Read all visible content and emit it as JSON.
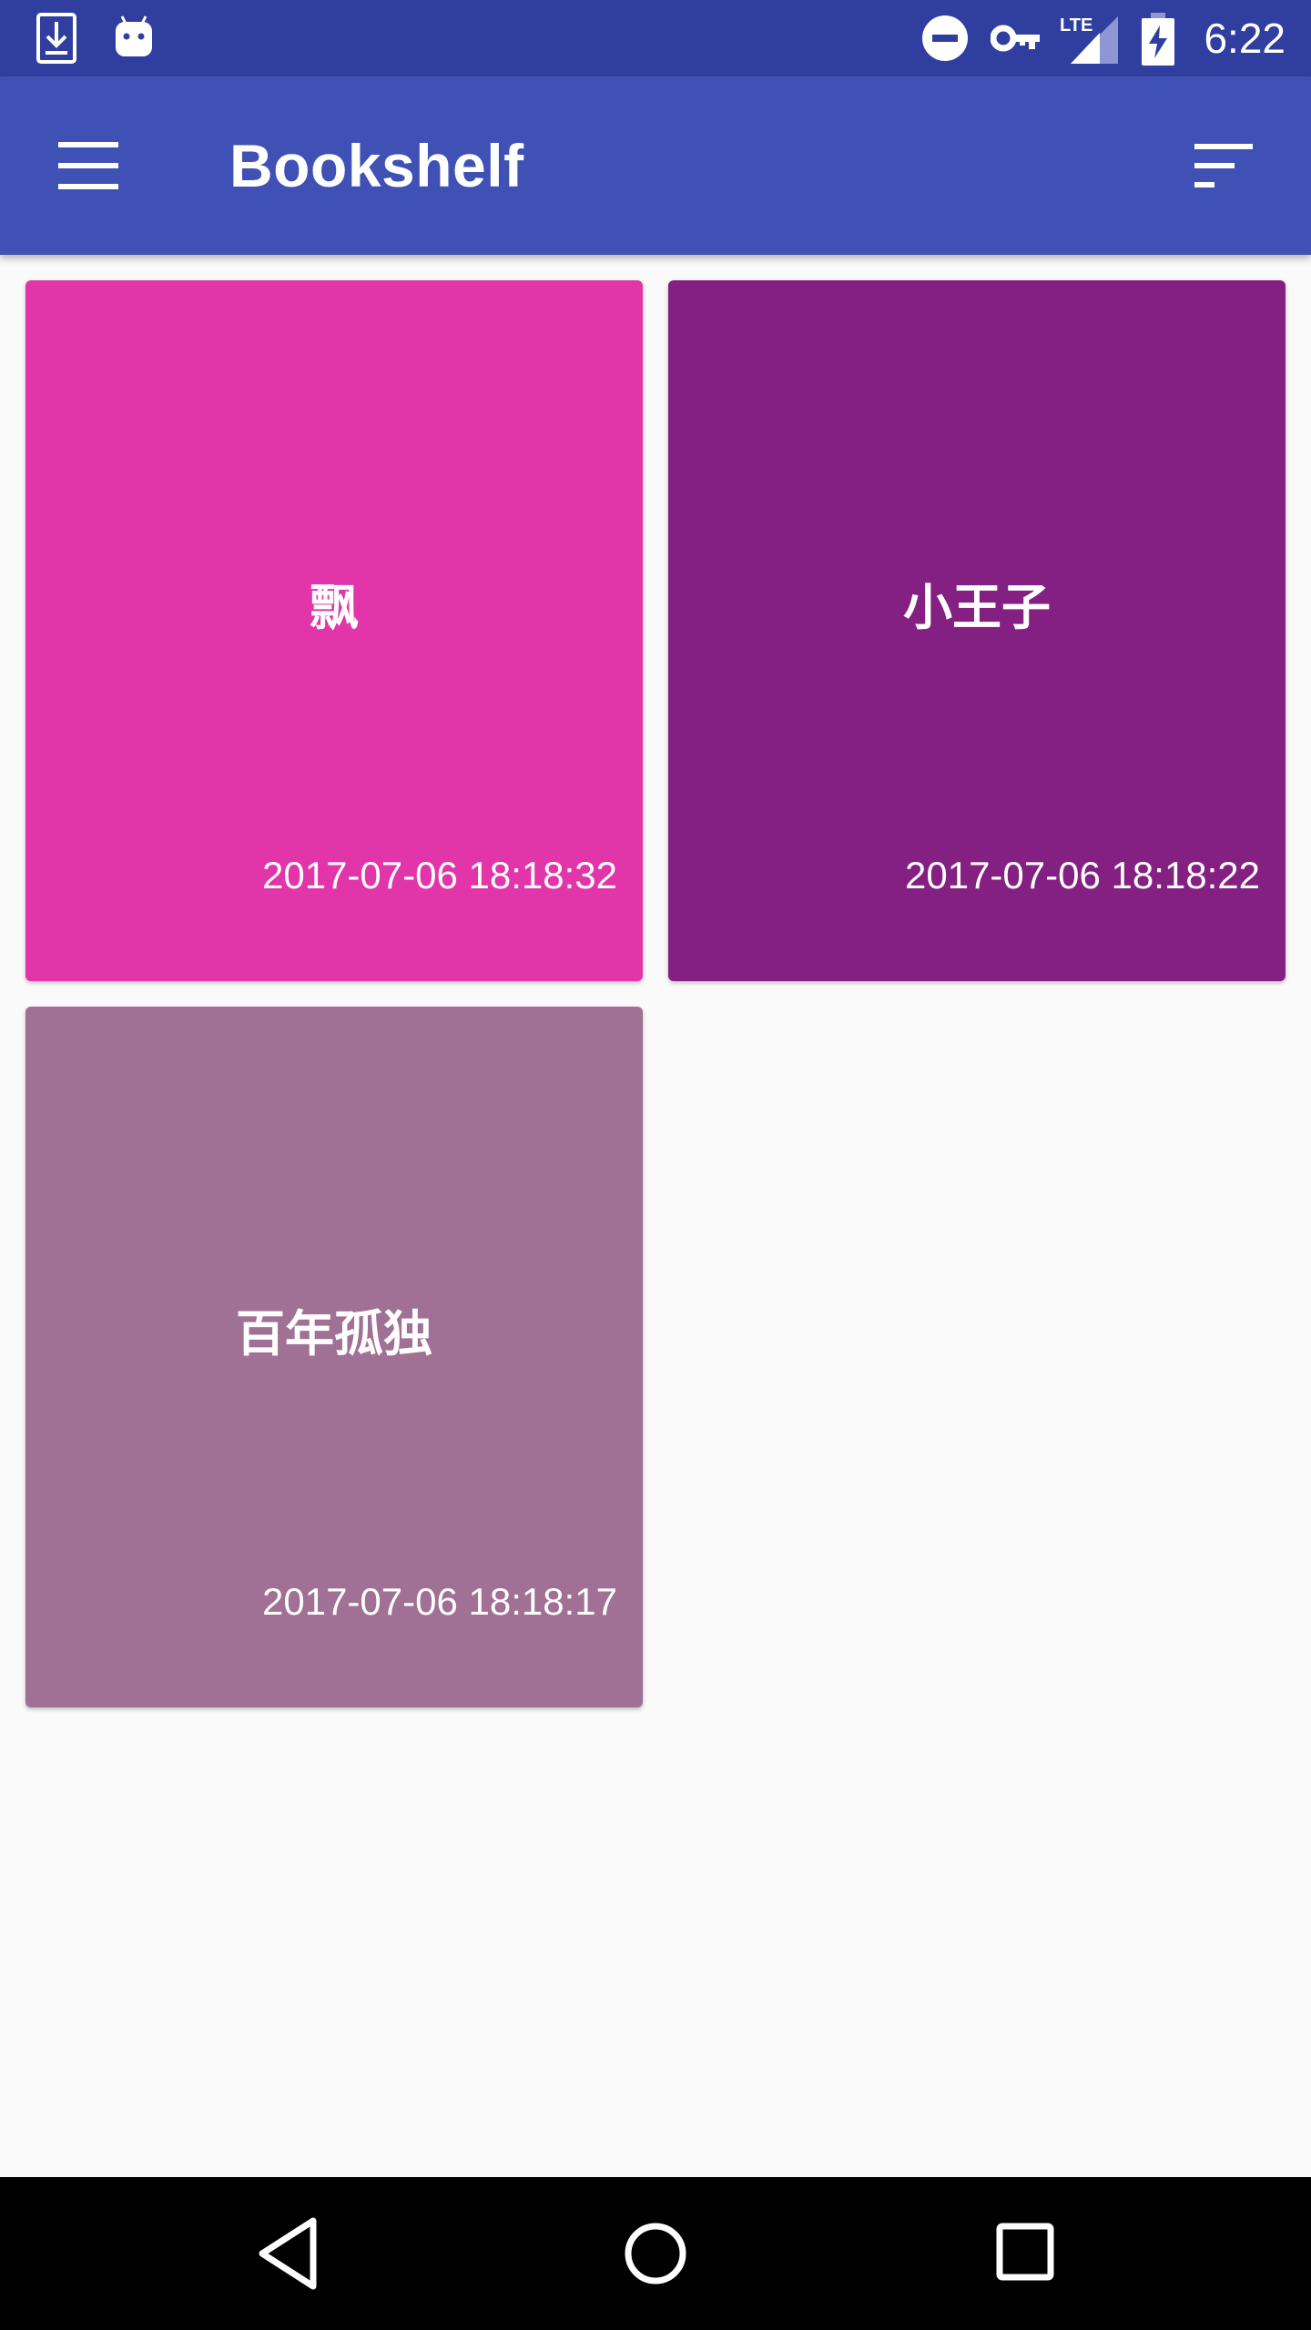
{
  "status_bar": {
    "time": "6:22",
    "network_label": "LTE",
    "icons": [
      "download-notification-icon",
      "android-notification-icon",
      "do-not-disturb-icon",
      "vpn-key-icon",
      "lte-signal-icon",
      "battery-charging-icon"
    ]
  },
  "app_bar": {
    "title": "Bookshelf",
    "nav_icon": "menu-icon",
    "action_icon": "sort-icon",
    "color": "#3f51b5"
  },
  "books": [
    {
      "title": "飘",
      "date": "2017-07-06 18:18:32",
      "color": "#e135a9"
    },
    {
      "title": "小王子",
      "date": "2017-07-06 18:18:22",
      "color": "#832082"
    },
    {
      "title": "百年孤独",
      "date": "2017-07-06 18:18:17",
      "color": "#a07095"
    }
  ],
  "nav_bar": {
    "icons": [
      "back-icon",
      "home-icon",
      "recents-icon"
    ]
  }
}
